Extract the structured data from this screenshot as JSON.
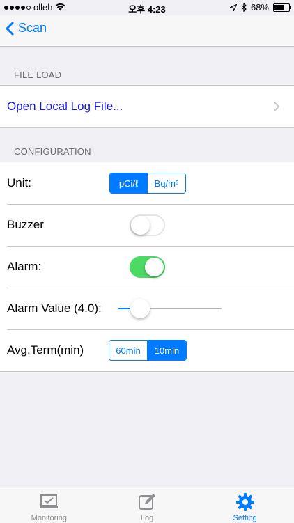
{
  "status_bar": {
    "carrier": "olleh",
    "time": "오후 4:23",
    "battery": "68%",
    "battery_level": 0.68
  },
  "nav": {
    "back_label": "Scan"
  },
  "file_load": {
    "header": "FILE LOAD",
    "open_label": "Open Local Log File..."
  },
  "configuration": {
    "header": "CONFIGURATION",
    "unit": {
      "label": "Unit:",
      "options": [
        "pCi/ℓ",
        "Bq/m³"
      ],
      "selected": 0
    },
    "buzzer": {
      "label": "Buzzer",
      "on": false
    },
    "alarm": {
      "label": "Alarm:",
      "on": true
    },
    "alarm_value": {
      "label": "Alarm Value (4.0):",
      "level": 0.21
    },
    "avg_term": {
      "label": "Avg.Term(min)",
      "options": [
        "60min",
        "10min"
      ],
      "selected": 1
    }
  },
  "tabs": [
    {
      "label": "Monitoring",
      "icon": "monitor-check-icon"
    },
    {
      "label": "Log",
      "icon": "edit-note-icon"
    },
    {
      "label": "Setting",
      "icon": "gear-icon",
      "active": true
    }
  ],
  "colors": {
    "accent": "#007aff",
    "switch_on": "#4cd964",
    "link": "#1a1adc",
    "background": "#efeff4"
  }
}
